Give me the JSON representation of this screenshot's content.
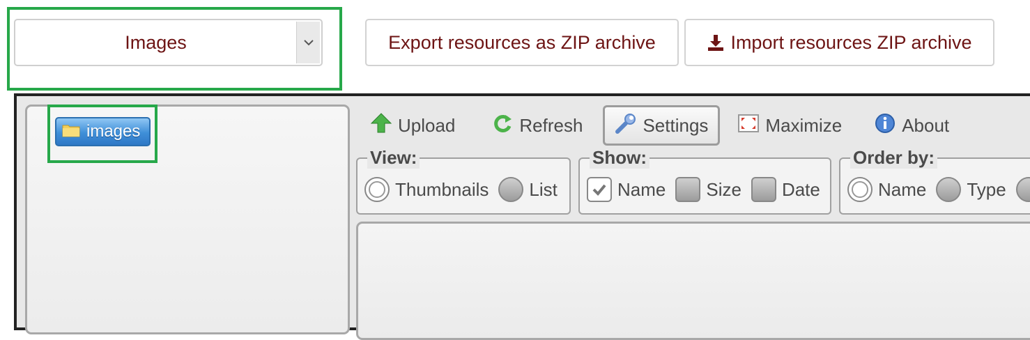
{
  "resource_type": {
    "selected": "Images"
  },
  "top_buttons": {
    "export_label": "Export resources as ZIP archive",
    "import_label": "Import resources ZIP archive"
  },
  "tree": {
    "folder": "images"
  },
  "toolbar": {
    "upload": "Upload",
    "refresh": "Refresh",
    "settings": "Settings",
    "maximize": "Maximize",
    "about": "About"
  },
  "view": {
    "legend": "View:",
    "options": [
      "Thumbnails",
      "List"
    ],
    "selected": "Thumbnails"
  },
  "show": {
    "legend": "Show:",
    "options": [
      "Name",
      "Size",
      "Date"
    ],
    "checked": [
      "Name"
    ]
  },
  "order_by": {
    "legend": "Order by:",
    "options": [
      "Name",
      "Type"
    ],
    "selected": "Name"
  },
  "colors": {
    "highlight": "#27a84a",
    "link_text": "#6d1414",
    "folder_selected": "#3f8fd8"
  }
}
